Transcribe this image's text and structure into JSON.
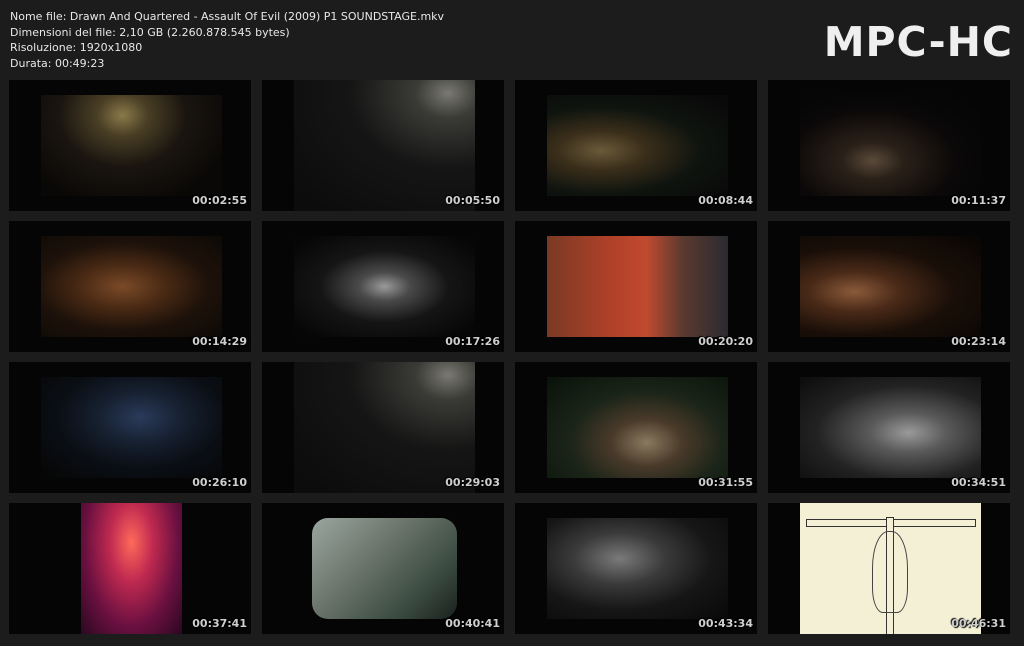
{
  "info": {
    "file_name": "Nome file: Drawn And Quartered - Assault Of Evil (2009) P1 SOUNDSTAGE.mkv",
    "file_size": "Dimensioni del file: 2,10 GB (2.260.878.545 bytes)",
    "resolution": "Risoluzione: 1920x1080",
    "duration": "Durata: 00:49:23"
  },
  "logo": "MPC-HC",
  "thumbnails": [
    {
      "time": "00:02:55"
    },
    {
      "time": "00:05:50"
    },
    {
      "time": "00:08:44"
    },
    {
      "time": "00:11:37"
    },
    {
      "time": "00:14:29"
    },
    {
      "time": "00:17:26"
    },
    {
      "time": "00:20:20"
    },
    {
      "time": "00:23:14"
    },
    {
      "time": "00:26:10"
    },
    {
      "time": "00:29:03"
    },
    {
      "time": "00:31:55"
    },
    {
      "time": "00:34:51"
    },
    {
      "time": "00:37:41"
    },
    {
      "time": "00:40:41"
    },
    {
      "time": "00:43:34"
    },
    {
      "time": "00:46:31"
    }
  ]
}
